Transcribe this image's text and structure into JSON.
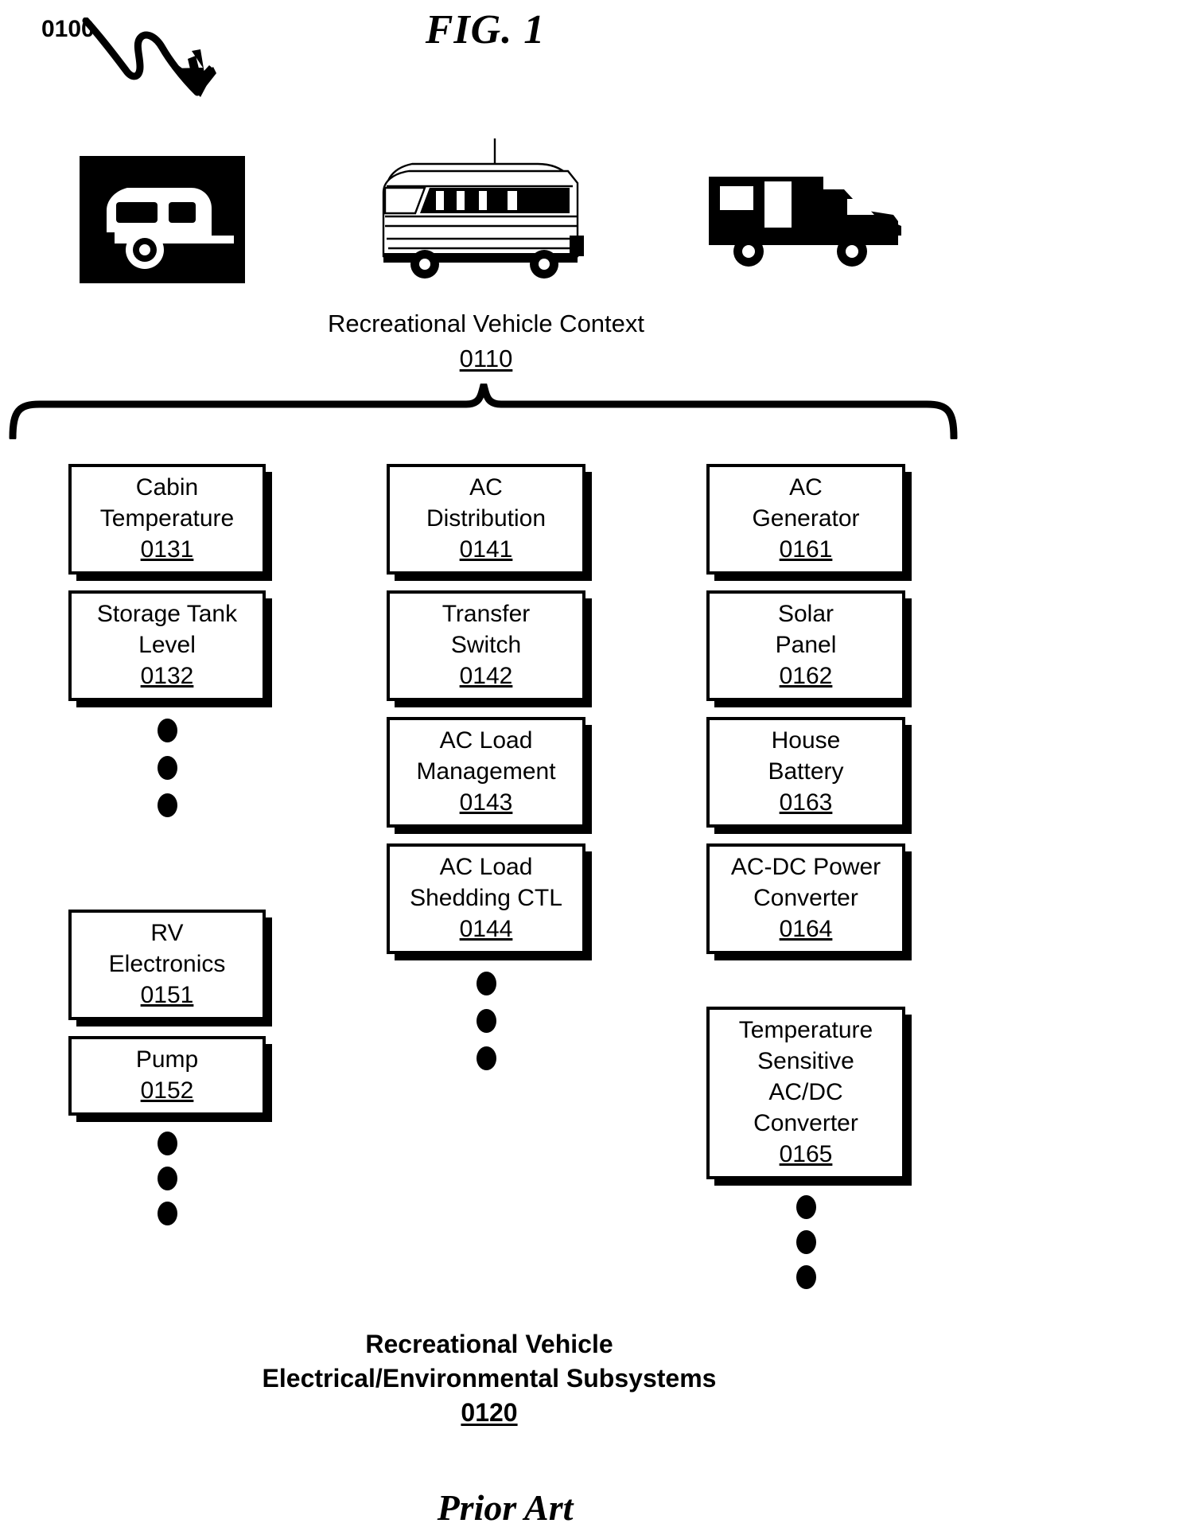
{
  "figure": {
    "ref_number": "0100",
    "title": "FIG. 1",
    "prior_art_label": "Prior Art"
  },
  "context": {
    "caption": "Recreational Vehicle Context",
    "ref": "0110",
    "images": [
      {
        "name": "travel-trailer-icon",
        "alt": "Travel trailer / caravan silhouette in black square"
      },
      {
        "name": "class-a-motorhome-illustration",
        "alt": "Class A motorhome line illustration"
      },
      {
        "name": "class-c-motorhome-icon",
        "alt": "Class C motorhome black silhouette"
      }
    ]
  },
  "subsystems": {
    "caption_line1": "Recreational Vehicle",
    "caption_line2": "Electrical/Environmental Subsystems",
    "ref": "0120",
    "columns": [
      {
        "name": "sensors-column",
        "boxes": [
          {
            "lines": [
              "Cabin",
              "Temperature"
            ],
            "ref": "0131"
          },
          {
            "lines": [
              "Storage Tank",
              "Level"
            ],
            "ref": "0132"
          }
        ],
        "boxes2": [
          {
            "lines": [
              "RV",
              "Electronics"
            ],
            "ref": "0151"
          },
          {
            "lines": [
              "Pump"
            ],
            "ref": "0152"
          }
        ]
      },
      {
        "name": "ac-column",
        "boxes": [
          {
            "lines": [
              "AC",
              "Distribution"
            ],
            "ref": "0141"
          },
          {
            "lines": [
              "Transfer",
              "Switch"
            ],
            "ref": "0142"
          },
          {
            "lines": [
              "AC Load",
              "Management"
            ],
            "ref": "0143"
          },
          {
            "lines": [
              "AC Load",
              "Shedding CTL"
            ],
            "ref": "0144"
          }
        ]
      },
      {
        "name": "power-column",
        "boxes": [
          {
            "lines": [
              "AC",
              "Generator"
            ],
            "ref": "0161"
          },
          {
            "lines": [
              "Solar",
              "Panel"
            ],
            "ref": "0162"
          },
          {
            "lines": [
              "House",
              "Battery"
            ],
            "ref": "0163"
          },
          {
            "lines": [
              "AC-DC Power",
              "Converter"
            ],
            "ref": "0164"
          },
          {
            "lines": [
              "Temperature",
              "Sensitive",
              "AC/DC",
              "Converter"
            ],
            "ref": "0165"
          }
        ]
      }
    ]
  },
  "colors": {
    "ink": "#000000",
    "paper": "#ffffff"
  }
}
